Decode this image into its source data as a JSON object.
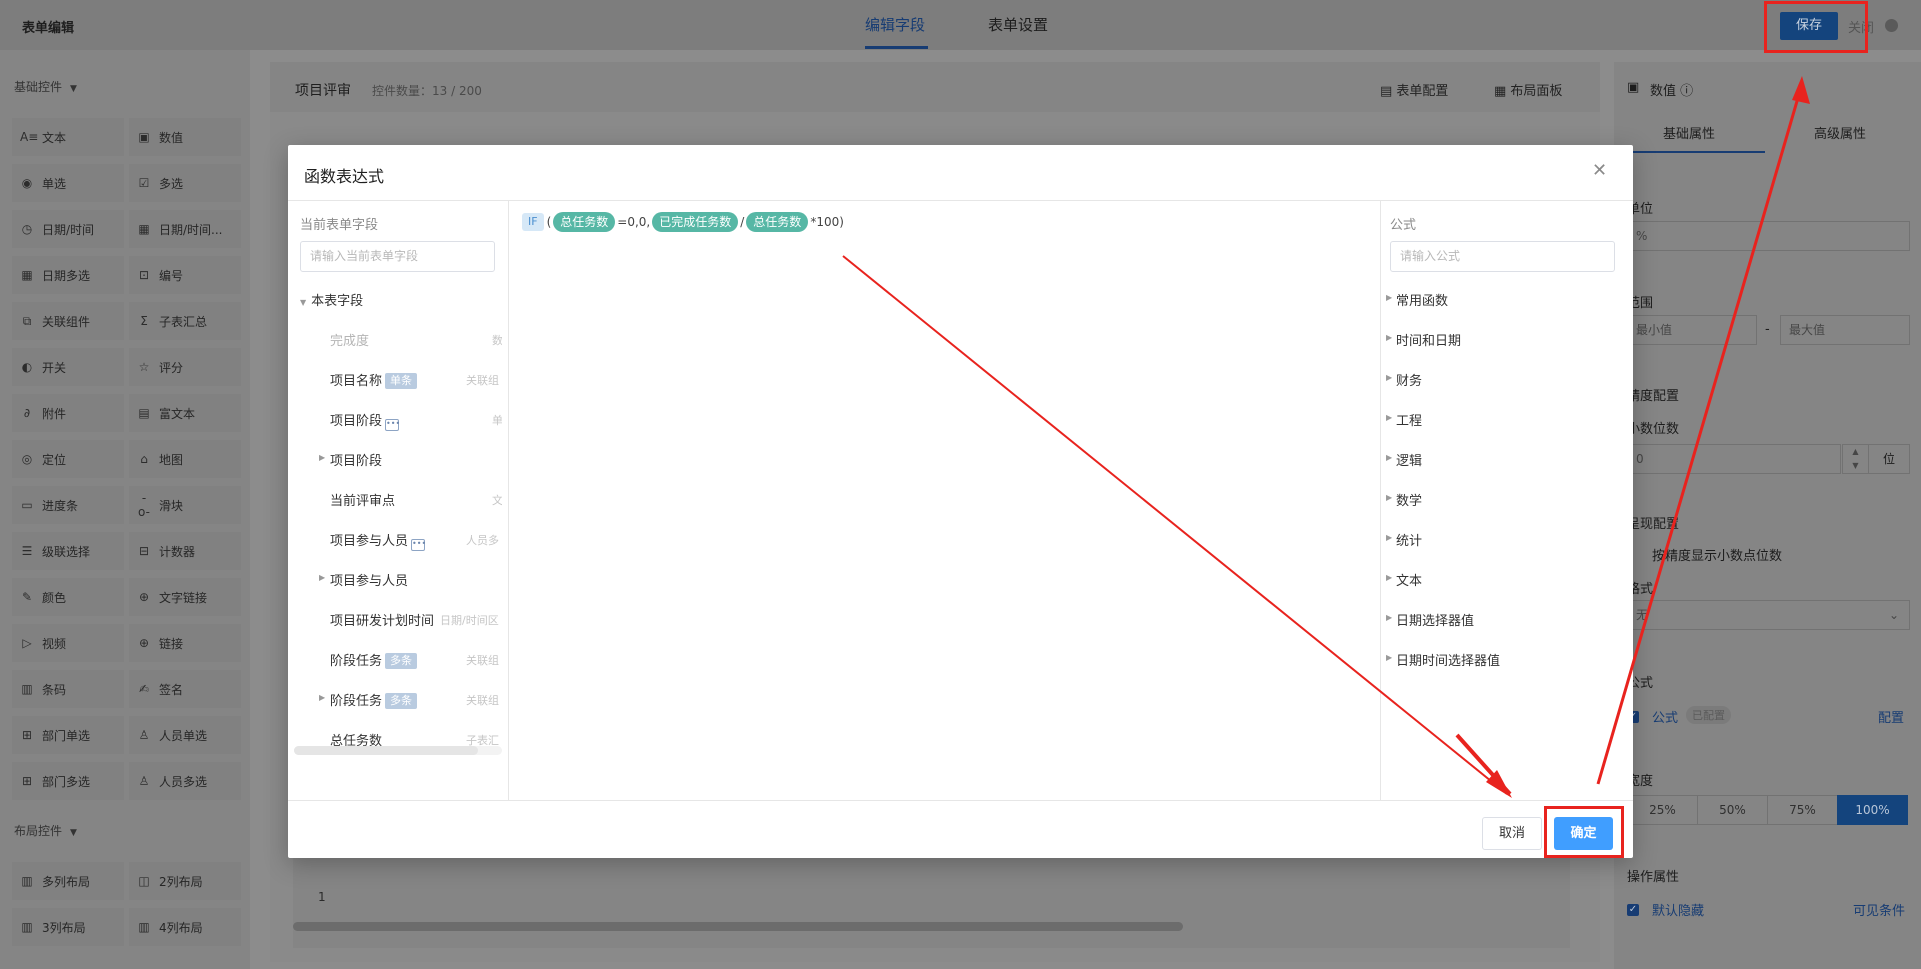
{
  "topbar": {
    "app_title": "表单编辑",
    "tabs": [
      {
        "label": "编辑字段"
      },
      {
        "label": "表单设置"
      }
    ],
    "save_label": "保存",
    "close_label": "关闭"
  },
  "palette": {
    "basic_title": "基础控件",
    "basic_items": [
      {
        "label": "文本",
        "icon": "text-icon",
        "glyph": "A≡"
      },
      {
        "label": "数值",
        "icon": "number-icon",
        "glyph": "▣"
      },
      {
        "label": "单选",
        "icon": "radio-icon",
        "glyph": "◉"
      },
      {
        "label": "多选",
        "icon": "checkbox-icon",
        "glyph": "☑"
      },
      {
        "label": "日期/时间",
        "icon": "clock-icon",
        "glyph": "◷"
      },
      {
        "label": "日期/时间...",
        "icon": "calendar-icon",
        "glyph": "▦"
      },
      {
        "label": "日期多选",
        "icon": "calendar-multi-icon",
        "glyph": "▦"
      },
      {
        "label": "编号",
        "icon": "serial-icon",
        "glyph": "⊡"
      },
      {
        "label": "关联组件",
        "icon": "link-component-icon",
        "glyph": "⧉"
      },
      {
        "label": "子表汇总",
        "icon": "sigma-icon",
        "glyph": "Σ"
      },
      {
        "label": "开关",
        "icon": "toggle-icon",
        "glyph": "◐"
      },
      {
        "label": "评分",
        "icon": "star-icon",
        "glyph": "☆"
      },
      {
        "label": "附件",
        "icon": "paperclip-icon",
        "glyph": "∂"
      },
      {
        "label": "富文本",
        "icon": "richtext-icon",
        "glyph": "▤"
      },
      {
        "label": "定位",
        "icon": "location-icon",
        "glyph": "◎"
      },
      {
        "label": "地图",
        "icon": "map-icon",
        "glyph": "⌂"
      },
      {
        "label": "进度条",
        "icon": "progress-icon",
        "glyph": "▭"
      },
      {
        "label": "滑块",
        "icon": "slider-icon",
        "glyph": "-o-"
      },
      {
        "label": "级联选择",
        "icon": "cascade-icon",
        "glyph": "☰"
      },
      {
        "label": "计数器",
        "icon": "counter-icon",
        "glyph": "⊟"
      },
      {
        "label": "颜色",
        "icon": "color-picker-icon",
        "glyph": "✎"
      },
      {
        "label": "文字链接",
        "icon": "globe-icon",
        "glyph": "⊕"
      },
      {
        "label": "视频",
        "icon": "video-icon",
        "glyph": "▷"
      },
      {
        "label": "链接",
        "icon": "globe-link-icon",
        "glyph": "⊕"
      },
      {
        "label": "条码",
        "icon": "barcode-icon",
        "glyph": "▥"
      },
      {
        "label": "签名",
        "icon": "signature-icon",
        "glyph": "✍"
      },
      {
        "label": "部门单选",
        "icon": "department-icon",
        "glyph": "⊞"
      },
      {
        "label": "人员单选",
        "icon": "person-icon",
        "glyph": "♙"
      },
      {
        "label": "部门多选",
        "icon": "department-multi-icon",
        "glyph": "⊞"
      },
      {
        "label": "人员多选",
        "icon": "people-icon",
        "glyph": "♙"
      }
    ],
    "layout_title": "布局控件",
    "layout_items": [
      {
        "label": "多列布局",
        "icon": "multi-column-icon",
        "glyph": "▥"
      },
      {
        "label": "2列布局",
        "icon": "two-column-icon",
        "glyph": "◫"
      },
      {
        "label": "3列布局",
        "icon": "three-column-icon",
        "glyph": "▥"
      },
      {
        "label": "4列布局",
        "icon": "four-column-icon",
        "glyph": "▥"
      }
    ]
  },
  "canvas": {
    "title": "项目评审",
    "count": "控件数量：13 / 200",
    "form_config": "表单配置",
    "layout_panel": "布局面板",
    "row_number": "1"
  },
  "props": {
    "title": "数值",
    "tab_basic": "基础属性",
    "tab_advanced": "高级属性",
    "unit_label": "单位",
    "unit_value": "%",
    "range_label": "范围",
    "range_min_placeholder": "最小值",
    "range_sep": "-",
    "range_max_placeholder": "最大值",
    "precision_label": "精度配置",
    "decimal_label": "小数位数",
    "decimal_value": "0",
    "decimal_unit": "位",
    "display_label": "呈现配置",
    "display_option": "按精度显示小数点位数",
    "format_label": "格式",
    "format_value": "无",
    "formula_label": "公式",
    "formula_check": "公式",
    "formula_badge": "已配置",
    "formula_link": "配置",
    "width_label": "宽度",
    "width_options": [
      "25%",
      "50%",
      "75%",
      "100%"
    ],
    "ops_label": "操作属性",
    "default_hidden": "默认隐藏",
    "visible_condition": "可见条件"
  },
  "modal": {
    "title": "函数表达式",
    "fields_label": "当前表单字段",
    "fields_placeholder": "请输入当前表单字段",
    "tree_root": "本表字段",
    "fields": [
      {
        "name": "完成度",
        "tag": "",
        "type": "数",
        "dim": true,
        "expand": false,
        "more": false
      },
      {
        "name": "项目名称",
        "tag": "单条",
        "type": "关联组",
        "dim": false,
        "expand": false,
        "more": false
      },
      {
        "name": "项目阶段",
        "tag": "",
        "type": "单",
        "dim": false,
        "expand": false,
        "more": true
      },
      {
        "name": "项目阶段",
        "tag": "",
        "type": "",
        "dim": false,
        "expand": true,
        "more": false
      },
      {
        "name": "当前评审点",
        "tag": "",
        "type": "文",
        "dim": false,
        "expand": false,
        "more": false
      },
      {
        "name": "项目参与人员",
        "tag": "",
        "type": "人员多",
        "dim": false,
        "expand": false,
        "more": true
      },
      {
        "name": "项目参与人员",
        "tag": "",
        "type": "",
        "dim": false,
        "expand": true,
        "more": false
      },
      {
        "name": "项目研发计划时间",
        "tag": "",
        "type": "日期/时间区",
        "dim": false,
        "expand": false,
        "more": false
      },
      {
        "name": "阶段任务",
        "tag": "多条",
        "type": "关联组",
        "dim": false,
        "expand": false,
        "more": false
      },
      {
        "name": "阶段任务",
        "tag": "多条",
        "type": "关联组",
        "dim": false,
        "expand": true,
        "more": false
      },
      {
        "name": "总任务数",
        "tag": "",
        "type": "子表汇",
        "dim": false,
        "expand": false,
        "more": false
      }
    ],
    "formula": {
      "fn": "IF",
      "open": "(",
      "var1": "总任务数",
      "t1": "=0,0,",
      "var2": "已完成任务数",
      "t2": "/",
      "var3": "总任务数",
      "t3": "*100)"
    },
    "formula_label": "公式",
    "formula_placeholder": "请输入公式",
    "categories": [
      "常用函数",
      "时间和日期",
      "财务",
      "工程",
      "逻辑",
      "数学",
      "统计",
      "文本",
      "日期选择器值",
      "日期时间选择器值"
    ],
    "cancel_label": "取消",
    "ok_label": "确定"
  }
}
